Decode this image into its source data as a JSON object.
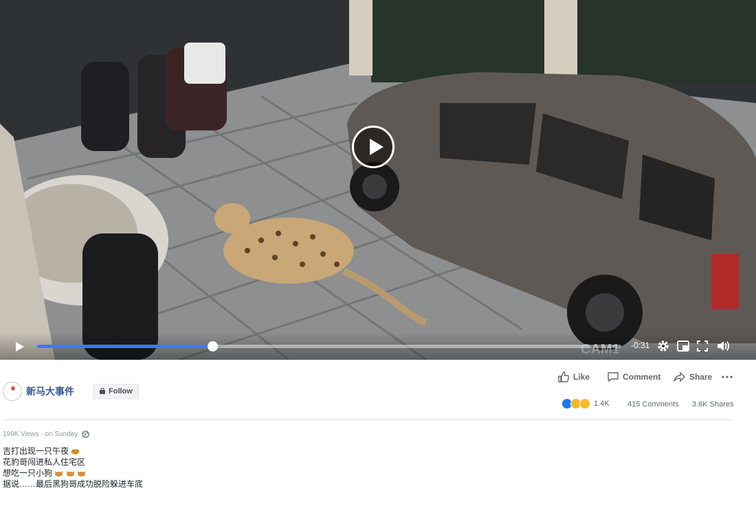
{
  "video": {
    "scene": "cctv-leopard-driveway",
    "remaining_time": "-0:31",
    "progress": 0.3,
    "watermark": "CAM1",
    "icons": [
      "play-icon",
      "gear-icon",
      "picture-in-picture-icon",
      "fullscreen-icon",
      "volume-icon"
    ]
  },
  "post": {
    "page_name": "新马大事件",
    "follow_label": "Follow",
    "actions": {
      "like_label": "Like",
      "comment_label": "Comment",
      "share_label": "Share"
    },
    "reaction_count": "1.4K",
    "comments_count": "415 Comments",
    "shares_count": "3.6K Shares",
    "views": "199K Views",
    "posted": "on Sunday",
    "caption_lines": [
      "吉打出现一只午夜",
      "花豹哥闯进私人住宅区",
      "想吃一只小狗",
      "据说……最后黑狗哥成功脱险躲进车底"
    ]
  },
  "colors": {
    "link_blue": "#385898",
    "progress_blue": "#3b7af6",
    "muted_gray": "#606770"
  }
}
